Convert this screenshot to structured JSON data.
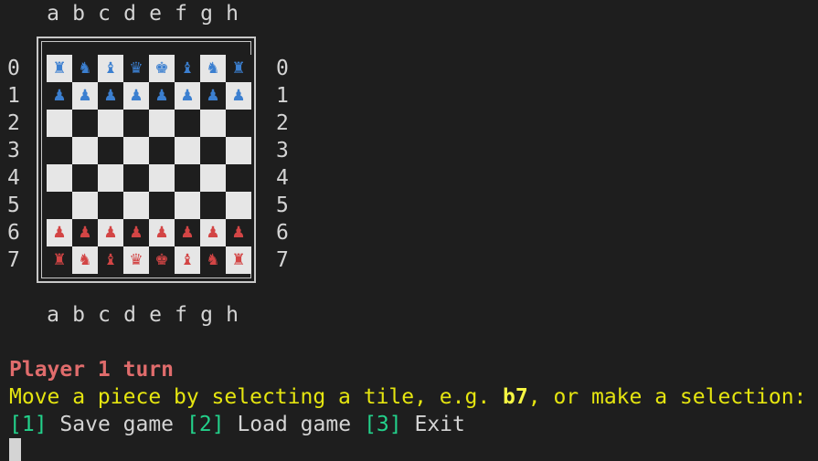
{
  "board": {
    "files": [
      "a",
      "b",
      "c",
      "d",
      "e",
      "f",
      "g",
      "h"
    ],
    "ranks": [
      "0",
      "1",
      "2",
      "3",
      "4",
      "5",
      "6",
      "7"
    ],
    "rows": [
      [
        "♜",
        "♞",
        "♝",
        "♛",
        "♚",
        "♝",
        "♞",
        "♜"
      ],
      [
        "♟",
        "♟",
        "♟",
        "♟",
        "♟",
        "♟",
        "♟",
        "♟"
      ],
      [
        "",
        "",
        "",
        "",
        "",
        "",
        "",
        ""
      ],
      [
        "",
        "",
        "",
        "",
        "",
        "",
        "",
        ""
      ],
      [
        "",
        "",
        "",
        "",
        "",
        "",
        "",
        ""
      ],
      [
        "",
        "",
        "",
        "",
        "",
        "",
        "",
        ""
      ],
      [
        "♟",
        "♟",
        "♟",
        "♟",
        "♟",
        "♟",
        "♟",
        "♟"
      ],
      [
        "♜",
        "♞",
        "♝",
        "♛",
        "♚",
        "♝",
        "♞",
        "♜"
      ]
    ],
    "row_colors": [
      "blue",
      "blue",
      "",
      "",
      "",
      "",
      "red",
      "red"
    ],
    "colors": {
      "blue": "#3b7fd0",
      "red": "#d34545",
      "light_square": "#e6e6e6",
      "dark_square": "#1e1e1e"
    }
  },
  "status": {
    "turn": "Player 1 turn",
    "prompt_before": "Move a piece by selecting a tile, e.g. ",
    "prompt_example": "b7",
    "prompt_after": ", or make a selection:"
  },
  "menu": {
    "options": [
      {
        "key": "[1]",
        "label": "Save game"
      },
      {
        "key": "[2]",
        "label": "Load game"
      },
      {
        "key": "[3]",
        "label": "Exit"
      }
    ]
  }
}
